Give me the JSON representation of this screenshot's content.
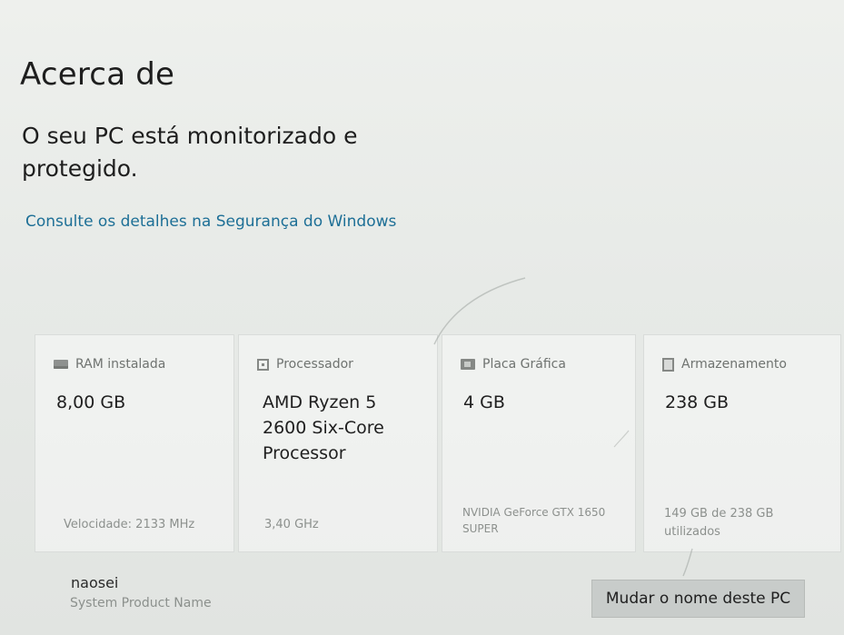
{
  "header": {
    "title": "Acerca de",
    "status_message": "O seu PC está monitorizado e protegido.",
    "security_link": "Consulte os detalhes na Segurança do Windows"
  },
  "specs": [
    {
      "icon": "ram-icon",
      "label": "RAM instalada",
      "value": "8,00 GB",
      "detail": "Velocidade: 2133 MHz"
    },
    {
      "icon": "processor-icon",
      "label": "Processador",
      "value": "AMD Ryzen 5 2600 Six-Core Processor",
      "detail": "3,40 GHz"
    },
    {
      "icon": "graphics-card-icon",
      "label": "Placa Gráfica",
      "value": "4 GB",
      "detail": "NVIDIA GeForce GTX 1650 SUPER"
    },
    {
      "icon": "storage-icon",
      "label": "Armazenamento",
      "value": "238 GB",
      "detail": "149 GB de 238 GB utilizados"
    }
  ],
  "pc": {
    "name": "naosei",
    "product_name": "System Product Name",
    "rename_button": "Mudar o nome deste PC"
  },
  "colors": {
    "link": "#1d6f96",
    "background": "#e9ebe8",
    "button": "#c8ccca"
  }
}
